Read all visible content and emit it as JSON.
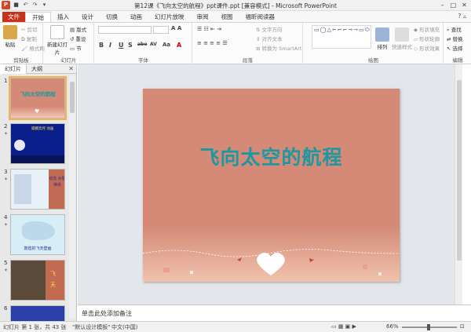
{
  "window": {
    "title": "第12课《飞向太空的航程》ppt课件.ppt [兼容模式] - Microsoft PowerPoint",
    "app_icon": "P"
  },
  "tabs": [
    "文件",
    "开始",
    "插入",
    "设计",
    "切换",
    "动画",
    "幻灯片放映",
    "审阅",
    "视图",
    "福昕阅读器"
  ],
  "active_tab": "开始",
  "ribbon": {
    "clipboard": {
      "paste": "粘贴",
      "cut": "剪切",
      "copy": "复制",
      "format_painter": "格式刷",
      "label": "剪贴板"
    },
    "slides": {
      "new_slide": "新建幻灯片",
      "layout": "版式",
      "reset": "重设",
      "section": "节",
      "label": "幻灯片"
    },
    "font": {
      "label": "字体",
      "size_controls": "A A",
      "bold": "B",
      "italic": "I",
      "underline": "U",
      "shadow": "S",
      "strike": "abe",
      "spacing": "AV",
      "case": "Aa",
      "color": "A"
    },
    "paragraph": {
      "label": "段落",
      "text_direction": "文字方向",
      "align_text": "对齐文本",
      "smartart": "转换为 SmartArt"
    },
    "drawing": {
      "label": "绘图",
      "arrange": "排列",
      "quick_styles": "快速样式",
      "shape_fill": "形状填充",
      "shape_outline": "形状轮廓",
      "shape_effects": "形状效果"
    },
    "editing": {
      "label": "编辑",
      "find": "查找",
      "replace": "替换",
      "select": "选择"
    }
  },
  "left_pane": {
    "tabs": [
      "幻灯片",
      "大纲"
    ],
    "thumbnails": [
      {
        "num": "1",
        "title": "飞向太空的航程"
      },
      {
        "num": "2",
        "text": "嫦娥奔月 动画"
      },
      {
        "num": "3",
        "text": "动态 对联 神舟"
      },
      {
        "num": "4",
        "text": "敦煌的飞天壁画"
      },
      {
        "num": "5",
        "text": "飞 天"
      },
      {
        "num": "6",
        "text": ""
      }
    ]
  },
  "slide": {
    "title": "飞向太空的航程",
    "bg_color": "#d48a77",
    "title_color": "#1c98a0"
  },
  "notes": {
    "placeholder": "单击此处添加备注"
  },
  "statusbar": {
    "slide_info": "幻灯片 第 1 张，共 43 张",
    "theme": "\"默认设计模板\"",
    "language": "中文(中国)",
    "zoom": "66%"
  }
}
